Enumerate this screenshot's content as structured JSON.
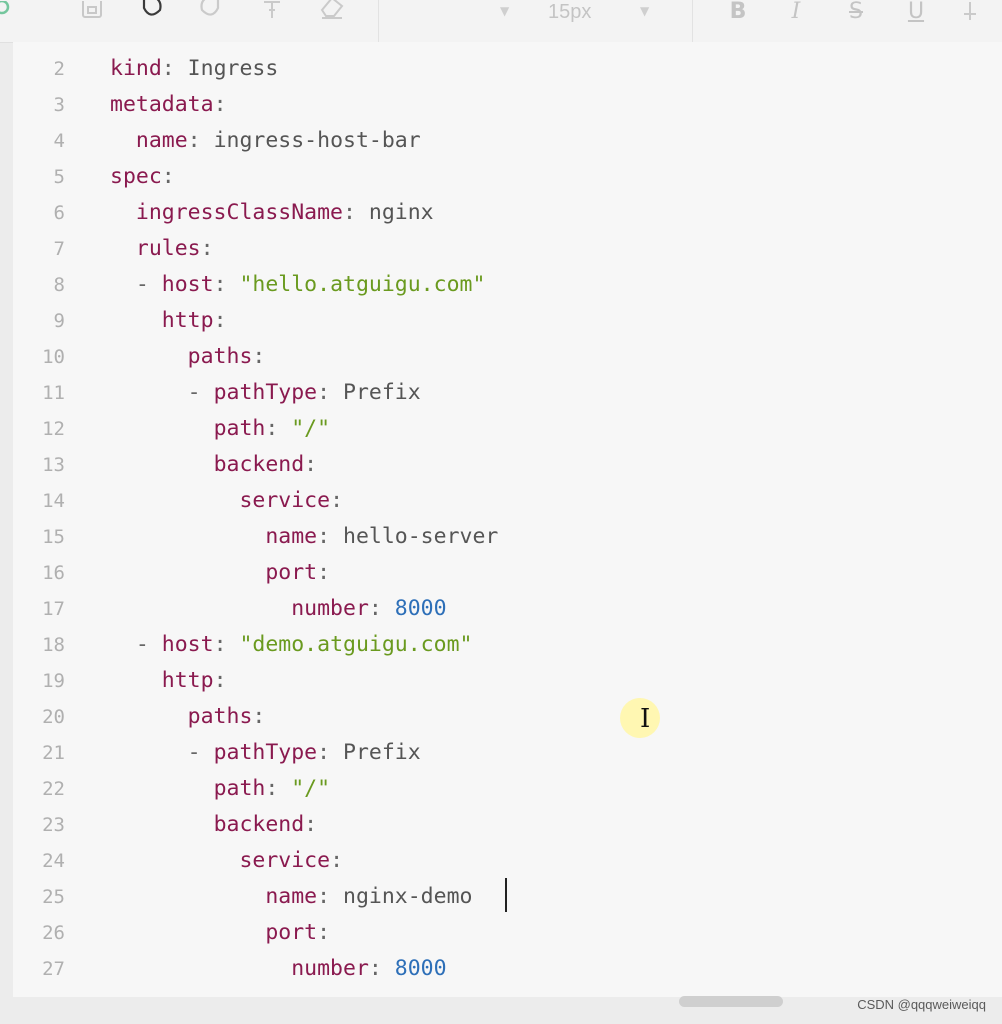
{
  "toolbar": {
    "font_size_value": "15px",
    "icons": [
      "gear-icon",
      "save-icon",
      "undo-icon",
      "redo-icon",
      "format-painter-icon",
      "eraser-icon",
      "font-family-dropdown",
      "bold-icon",
      "italic-icon",
      "strikethrough-icon",
      "underline-icon",
      "more-icon"
    ]
  },
  "editor": {
    "lines": [
      {
        "num": "2",
        "indent": "",
        "dash": "",
        "key": "kind",
        "colon": ":",
        "value": " Ingress",
        "value_type": "plain"
      },
      {
        "num": "3",
        "indent": "",
        "dash": "",
        "key": "metadata",
        "colon": ":",
        "value": "",
        "value_type": "plain"
      },
      {
        "num": "4",
        "indent": "  ",
        "dash": "",
        "key": "name",
        "colon": ":",
        "value": " ingress-host-bar",
        "value_type": "plain"
      },
      {
        "num": "5",
        "indent": "",
        "dash": "",
        "key": "spec",
        "colon": ":",
        "value": "",
        "value_type": "plain"
      },
      {
        "num": "6",
        "indent": "  ",
        "dash": "",
        "key": "ingressClassName",
        "colon": ":",
        "value": " nginx",
        "value_type": "plain"
      },
      {
        "num": "7",
        "indent": "  ",
        "dash": "",
        "key": "rules",
        "colon": ":",
        "value": "",
        "value_type": "plain"
      },
      {
        "num": "8",
        "indent": "  ",
        "dash": "- ",
        "key": "host",
        "colon": ":",
        "value": " \"hello.atguigu.com\"",
        "value_type": "string"
      },
      {
        "num": "9",
        "indent": "    ",
        "dash": "",
        "key": "http",
        "colon": ":",
        "value": "",
        "value_type": "plain"
      },
      {
        "num": "10",
        "indent": "      ",
        "dash": "",
        "key": "paths",
        "colon": ":",
        "value": "",
        "value_type": "plain"
      },
      {
        "num": "11",
        "indent": "      ",
        "dash": "- ",
        "key": "pathType",
        "colon": ":",
        "value": " Prefix",
        "value_type": "plain"
      },
      {
        "num": "12",
        "indent": "        ",
        "dash": "",
        "key": "path",
        "colon": ":",
        "value": " \"/\"",
        "value_type": "string"
      },
      {
        "num": "13",
        "indent": "        ",
        "dash": "",
        "key": "backend",
        "colon": ":",
        "value": "",
        "value_type": "plain"
      },
      {
        "num": "14",
        "indent": "          ",
        "dash": "",
        "key": "service",
        "colon": ":",
        "value": "",
        "value_type": "plain"
      },
      {
        "num": "15",
        "indent": "            ",
        "dash": "",
        "key": "name",
        "colon": ":",
        "value": " hello-server",
        "value_type": "plain"
      },
      {
        "num": "16",
        "indent": "            ",
        "dash": "",
        "key": "port",
        "colon": ":",
        "value": "",
        "value_type": "plain"
      },
      {
        "num": "17",
        "indent": "              ",
        "dash": "",
        "key": "number",
        "colon": ":",
        "value": " 8000",
        "value_type": "number"
      },
      {
        "num": "18",
        "indent": "  ",
        "dash": "- ",
        "key": "host",
        "colon": ":",
        "value": " \"demo.atguigu.com\"",
        "value_type": "string"
      },
      {
        "num": "19",
        "indent": "    ",
        "dash": "",
        "key": "http",
        "colon": ":",
        "value": "",
        "value_type": "plain"
      },
      {
        "num": "20",
        "indent": "      ",
        "dash": "",
        "key": "paths",
        "colon": ":",
        "value": "",
        "value_type": "plain"
      },
      {
        "num": "21",
        "indent": "      ",
        "dash": "- ",
        "key": "pathType",
        "colon": ":",
        "value": " Prefix",
        "value_type": "plain"
      },
      {
        "num": "22",
        "indent": "        ",
        "dash": "",
        "key": "path",
        "colon": ":",
        "value": " \"/\"",
        "value_type": "string"
      },
      {
        "num": "23",
        "indent": "        ",
        "dash": "",
        "key": "backend",
        "colon": ":",
        "value": "",
        "value_type": "plain"
      },
      {
        "num": "24",
        "indent": "          ",
        "dash": "",
        "key": "service",
        "colon": ":",
        "value": "",
        "value_type": "plain"
      },
      {
        "num": "25",
        "indent": "            ",
        "dash": "",
        "key": "name",
        "colon": ":",
        "value": " nginx-demo",
        "value_type": "plain"
      },
      {
        "num": "26",
        "indent": "            ",
        "dash": "",
        "key": "port",
        "colon": ":",
        "value": "",
        "value_type": "plain"
      },
      {
        "num": "27",
        "indent": "              ",
        "dash": "",
        "key": "number",
        "colon": ":",
        "value": " 8000",
        "value_type": "number"
      }
    ]
  },
  "colors": {
    "key": "#8a1a4f",
    "string": "#6a9a1f",
    "number": "#2d6fb8",
    "line_number": "#b0b0b0",
    "background": "#f7f7f7"
  },
  "watermark": "CSDN @qqqweiweiqq"
}
